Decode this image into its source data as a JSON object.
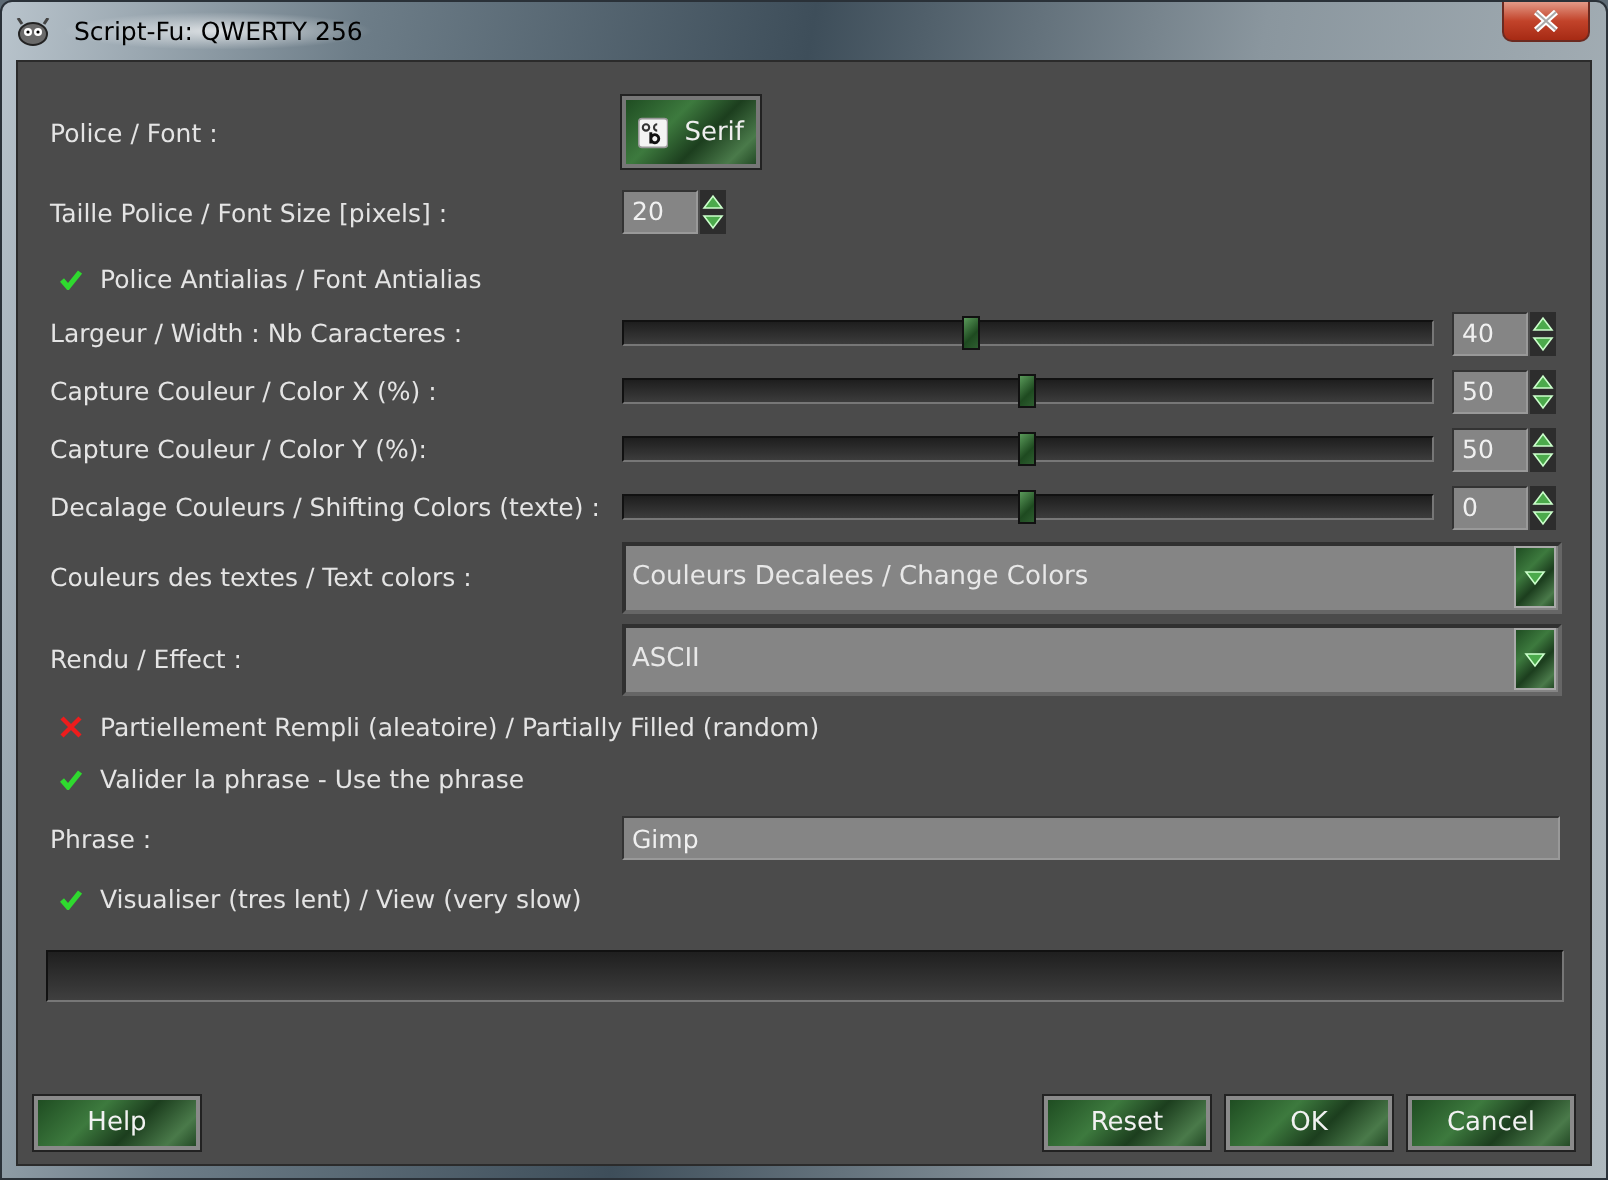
{
  "window": {
    "title": "Script-Fu: QWERTY 256"
  },
  "params": [
    {
      "kind": "font",
      "label": "Police / Font :",
      "value": "Serif"
    },
    {
      "kind": "spin",
      "label": "Taille Police / Font Size [pixels] :",
      "value": "20"
    },
    {
      "kind": "check",
      "label": "Police Antialias / Font Antialias",
      "checked": true
    },
    {
      "kind": "slider",
      "label": "Largeur / Width : Nb Caracteres :",
      "level": 0.43,
      "value": "40"
    },
    {
      "kind": "slider",
      "label": "Capture Couleur / Color X (%) :",
      "level": 0.5,
      "value": "50"
    },
    {
      "kind": "slider",
      "label": "Capture Couleur / Color Y (%):",
      "level": 0.5,
      "value": "50"
    },
    {
      "kind": "slider",
      "label": "Decalage Couleurs / Shifting Colors (texte) :",
      "level": 0.5,
      "value": "0"
    },
    {
      "kind": "combo",
      "label": "Couleurs des textes / Text colors :",
      "value": "Couleurs Decalees / Change Colors"
    },
    {
      "kind": "combo",
      "label": "Rendu / Effect :",
      "value": "ASCII"
    },
    {
      "kind": "check",
      "label": "Partiellement Rempli (aleatoire) / Partially Filled (random)",
      "checked": false
    },
    {
      "kind": "check",
      "label": "Valider la phrase - Use the phrase",
      "checked": true
    },
    {
      "kind": "text",
      "label": "Phrase :",
      "value": "Gimp"
    },
    {
      "kind": "check",
      "label": "Visualiser (tres lent) / View (very slow)",
      "checked": true
    }
  ],
  "progress": {
    "level": 0
  },
  "help_button": "Help",
  "buttons": [
    "Reset",
    "OK",
    "Cancel"
  ]
}
